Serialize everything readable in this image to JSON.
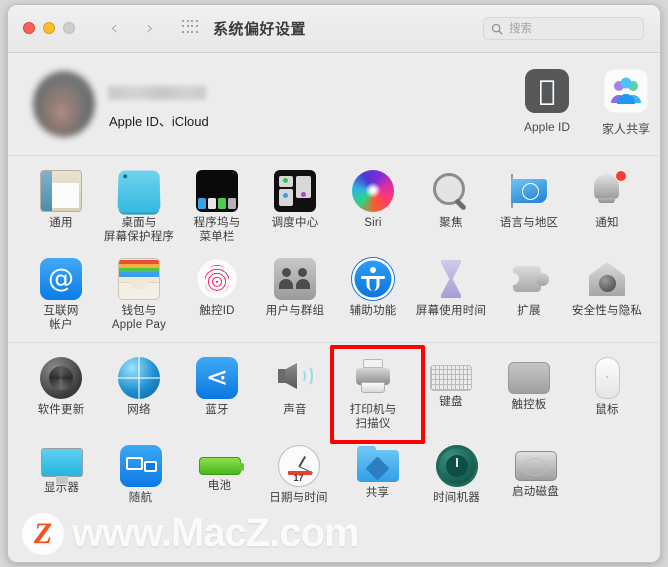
{
  "window": {
    "title": "系统偏好设置"
  },
  "titlebar": {
    "back_label": "‹",
    "forward_label": "›",
    "grid_icon": "grid-icon",
    "search_placeholder": "搜索",
    "search_value": ""
  },
  "account": {
    "name": "",
    "subtitle": "Apple ID、iCloud",
    "tiles": [
      {
        "label": "Apple ID",
        "icon": "apple-logo-icon"
      },
      {
        "label": "家人共享",
        "icon": "family-sharing-icon"
      }
    ]
  },
  "panes": [
    {
      "rows": [
        [
          {
            "label": [
              "通用"
            ],
            "icon": "general-icon",
            "art": "general"
          },
          {
            "label": [
              "桌面与",
              "屏幕保护程序"
            ],
            "icon": "desktop-screensaver-icon",
            "art": "desktop"
          },
          {
            "label": [
              "程序坞与",
              "菜单栏"
            ],
            "icon": "dock-menubar-icon",
            "art": "dock"
          },
          {
            "label": [
              "调度中心"
            ],
            "icon": "mission-control-icon",
            "art": "mission"
          },
          {
            "label": [
              "Siri"
            ],
            "icon": "siri-icon",
            "art": "siri"
          },
          {
            "label": [
              "聚焦"
            ],
            "icon": "spotlight-icon",
            "art": "spotlight"
          },
          {
            "label": [
              "语言与地区"
            ],
            "icon": "language-region-icon",
            "art": "language"
          },
          {
            "label": [
              "通知"
            ],
            "icon": "notifications-icon",
            "art": "notify",
            "badge": true
          }
        ],
        [
          {
            "label": [
              "互联网",
              "帐户"
            ],
            "icon": "internet-accounts-icon",
            "art": "internet"
          },
          {
            "label": [
              "钱包与",
              "Apple Pay"
            ],
            "icon": "wallet-apple-pay-icon",
            "art": "wallet"
          },
          {
            "label": [
              "触控ID"
            ],
            "icon": "touch-id-icon",
            "art": "touchid"
          },
          {
            "label": [
              "用户与群组"
            ],
            "icon": "users-groups-icon",
            "art": "users"
          },
          {
            "label": [
              "辅助功能"
            ],
            "icon": "accessibility-icon",
            "art": "access"
          },
          {
            "label": [
              "屏幕使用时间"
            ],
            "icon": "screen-time-icon",
            "art": "screentime"
          },
          {
            "label": [
              "扩展"
            ],
            "icon": "extensions-icon",
            "art": "extensions"
          },
          {
            "label": [
              "安全性与隐私"
            ],
            "icon": "security-privacy-icon",
            "art": "security"
          }
        ]
      ]
    },
    {
      "rows": [
        [
          {
            "label": [
              "软件更新"
            ],
            "icon": "software-update-icon",
            "art": "softupdate"
          },
          {
            "label": [
              "网络"
            ],
            "icon": "network-icon",
            "art": "network"
          },
          {
            "label": [
              "蓝牙"
            ],
            "icon": "bluetooth-icon",
            "art": "bluetooth"
          },
          {
            "label": [
              "声音"
            ],
            "icon": "sound-icon",
            "art": "sound"
          },
          {
            "label": [
              "打印机与",
              "扫描仪"
            ],
            "icon": "printers-scanners-icon",
            "art": "printer",
            "highlighted": true
          },
          {
            "label": [
              "键盘"
            ],
            "icon": "keyboard-icon",
            "art": "keyboard"
          },
          {
            "label": [
              "触控板"
            ],
            "icon": "trackpad-icon",
            "art": "trackpad"
          },
          {
            "label": [
              "鼠标"
            ],
            "icon": "mouse-icon",
            "art": "mouse"
          }
        ],
        [
          {
            "label": [
              "显示器"
            ],
            "icon": "displays-icon",
            "art": "display"
          },
          {
            "label": [
              "随航"
            ],
            "icon": "sidecar-icon",
            "art": "sidecar"
          },
          {
            "label": [
              "电池"
            ],
            "icon": "battery-icon",
            "art": "battery"
          },
          {
            "label": [
              "日期与时间"
            ],
            "icon": "date-time-icon",
            "art": "datetime",
            "clock_date": "17"
          },
          {
            "label": [
              "共享"
            ],
            "icon": "sharing-icon",
            "art": "sharing"
          },
          {
            "label": [
              "时间机器"
            ],
            "icon": "time-machine-icon",
            "art": "timemachine"
          },
          {
            "label": [
              "启动磁盘"
            ],
            "icon": "startup-disk-icon",
            "art": "startupdisk"
          }
        ]
      ]
    }
  ],
  "watermark": {
    "logo": "Z",
    "text": "www.MacZ.com"
  },
  "colors": {
    "window_bg": "#ececec",
    "titlebar_bg": "#f0f0f0",
    "highlight": "#ff0000",
    "badge": "#ff3b30",
    "accent_blue": "#0a77e0"
  }
}
